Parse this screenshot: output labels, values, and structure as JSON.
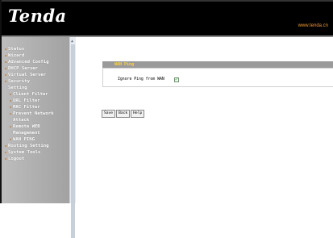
{
  "header": {
    "logo_text": "Tenda",
    "url": "www.tenda.cn"
  },
  "sidebar": {
    "items": [
      {
        "label": "Status",
        "level": 0
      },
      {
        "label": "Wizard",
        "level": 0
      },
      {
        "label": "Advanced Config",
        "level": 0
      },
      {
        "label": "DHCP Server",
        "level": 0
      },
      {
        "label": "Virtual Server",
        "level": 0
      },
      {
        "label": "Security",
        "level": 0
      },
      {
        "label": "Setting",
        "level": 0,
        "continuation": true
      },
      {
        "label": "Client Filter",
        "level": 1
      },
      {
        "label": "URL Filter",
        "level": 1
      },
      {
        "label": "MAC Filter",
        "level": 1
      },
      {
        "label": "Prevent Network",
        "level": 1
      },
      {
        "label": "Attack",
        "level": 1,
        "continuation": true
      },
      {
        "label": "Remote WEB",
        "level": 1
      },
      {
        "label": "Management",
        "level": 1,
        "continuation": true
      },
      {
        "label": "WAN PING",
        "level": 1
      },
      {
        "label": "Routing Setting",
        "level": 0
      },
      {
        "label": "System Tools",
        "level": 0
      },
      {
        "label": "Logout",
        "level": 0
      }
    ]
  },
  "main": {
    "panel_title": "WAN Ping",
    "ignore_ping_label": "Ignore Ping from WAN",
    "ignore_ping_checked": true,
    "buttons": {
      "save": "Save",
      "back": "Back",
      "help": "Help"
    }
  },
  "colors": {
    "header_bg": "#000000",
    "url_color": "#f29a2e",
    "sidebar_bg": "#b0b0b0",
    "panel_title_bg": "#9a9a9a",
    "panel_title_text": "#ffd23a",
    "check_color": "#1e9a1e"
  },
  "icons": {
    "checkbox": "check-icon",
    "scroll": "scroll-up-arrow-icon"
  }
}
